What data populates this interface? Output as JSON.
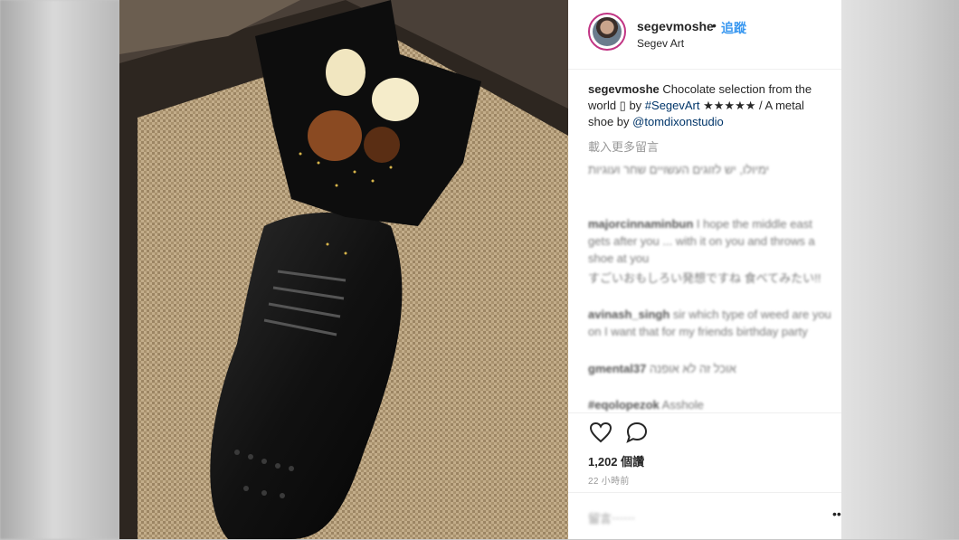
{
  "post": {
    "username": "segevmoshe",
    "dot": "•",
    "follow_label": "追蹤",
    "subtitle": "Segev Art",
    "caption_user": "segevmoshe",
    "caption_text1": " Chocolate selection from the world ▯ by ",
    "caption_tag": "#SegevArt",
    "caption_text2": " ★★★★★ / A metal shoe by ",
    "caption_mention": "@tomdixonstudio",
    "load_more": "載入更多留言",
    "comments": [
      {
        "user": "",
        "text": "ימיולו, יש לזוגים העשויים שחר ועוגיות"
      },
      {
        "user": "majorcinnaminbun",
        "text": " I hope the middle east gets after you ... with it on you and throws a shoe at you"
      },
      {
        "user": "",
        "text": "すごいおもしろい発想ですね 食べてみたい!!"
      },
      {
        "user": "avinash_singh",
        "text": " sir which type of weed are you on I want that for my friends birthday party"
      },
      {
        "user": "gmental37",
        "text": " אוכל זה לא אופנה"
      },
      {
        "user": "#eqolopezok",
        "text": " Asshole"
      }
    ],
    "likes": "1,202 個讚",
    "time": "22 小時前",
    "add_comment_placeholder": "留言⋯⋯",
    "more": "•••"
  },
  "icons": {
    "like": "heart-outline-icon",
    "comment": "speech-bubble-icon"
  }
}
